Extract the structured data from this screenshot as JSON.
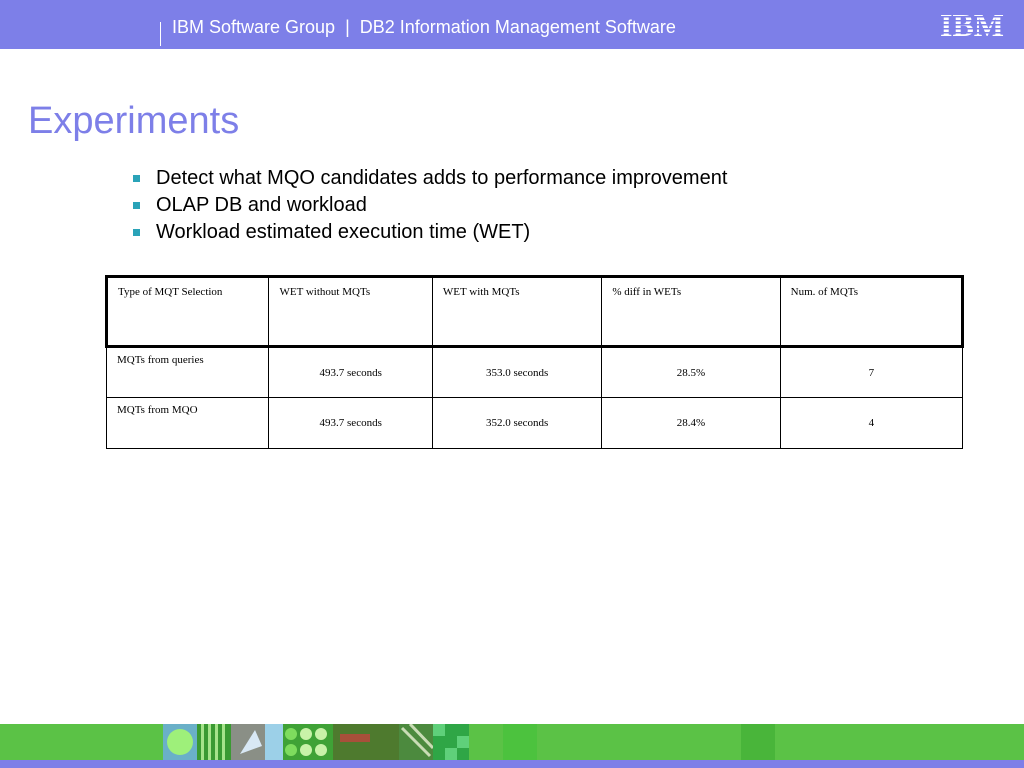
{
  "header": {
    "group": "IBM Software Group",
    "product": "DB2 Information Management Software",
    "separator": "|",
    "logo_text": "IBM",
    "bar_color": "#7d7fe8"
  },
  "slide": {
    "title": "Experiments",
    "bullets": [
      "Detect what MQO candidates adds to performance improvement",
      "OLAP DB and workload",
      "Workload estimated execution time (WET)"
    ],
    "bullet_icon": "square-bullet-icon",
    "bullet_color": "#2aa3b8"
  },
  "table": {
    "headers": [
      "Type of MQT Selection",
      "WET without MQTs",
      "WET with MQTs",
      "% diff in WETs",
      "Num. of MQTs"
    ],
    "rows": [
      [
        "MQTs from queries",
        "493.7 seconds",
        "353.0 seconds",
        "28.5%",
        "7"
      ],
      [
        "MQTs from MQO",
        "493.7 seconds",
        "352.0 seconds",
        "28.4%",
        "4"
      ]
    ]
  },
  "footer": {
    "bar_color": "#5bc246",
    "bottom_color": "#7d7fe8"
  }
}
